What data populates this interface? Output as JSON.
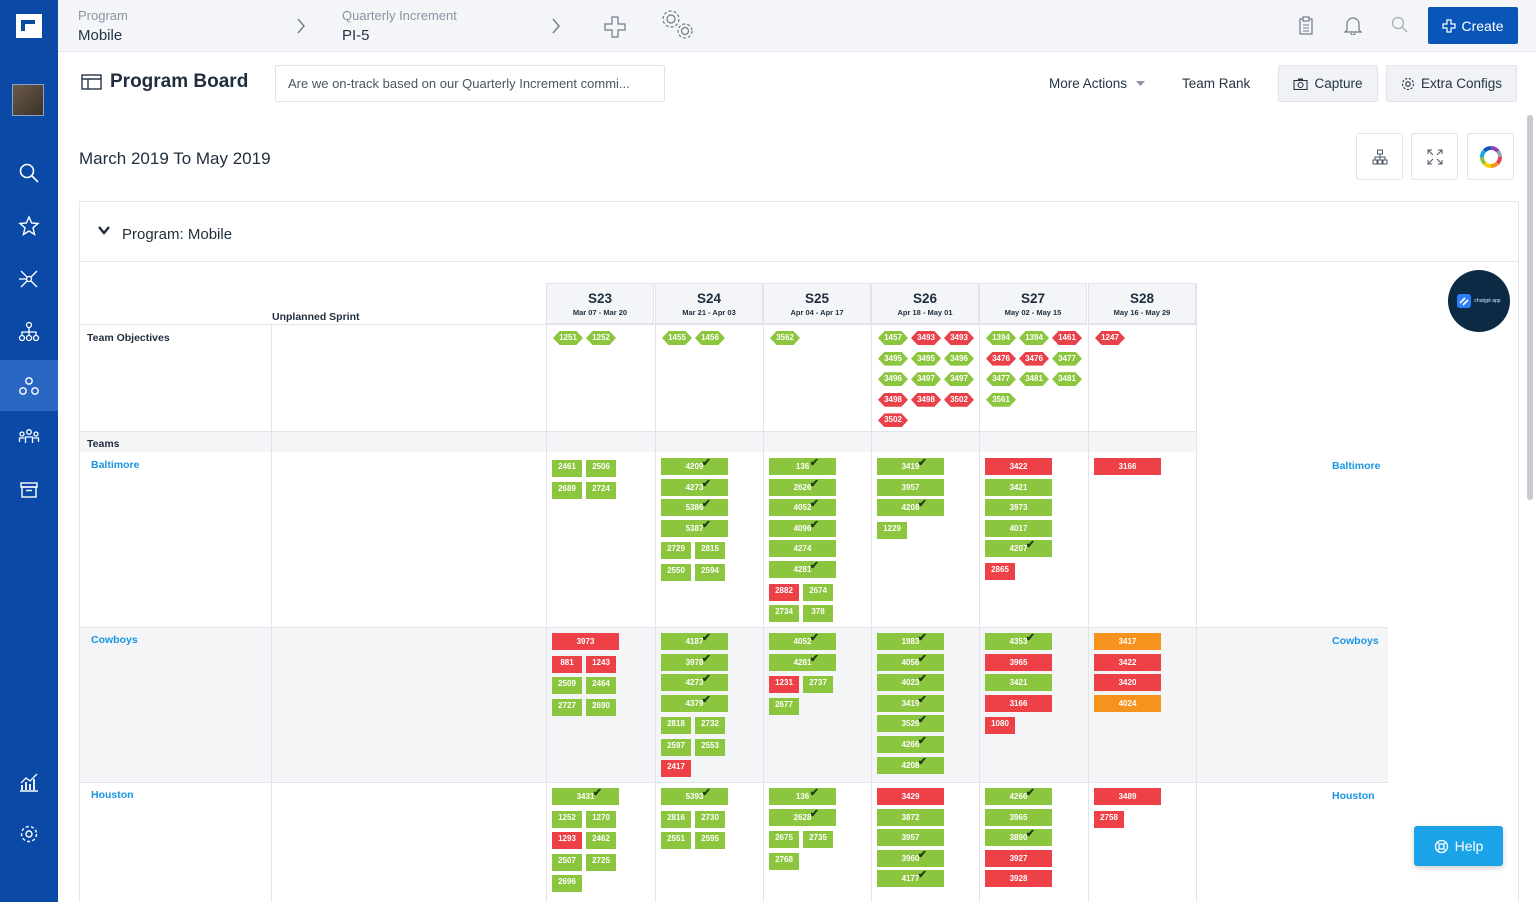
{
  "nav": {
    "items": [
      "search",
      "favorites",
      "network",
      "hierarchy",
      "program",
      "teams",
      "archive",
      "reports",
      "settings"
    ]
  },
  "topbar": {
    "program_label": "Program",
    "program_value": "Mobile",
    "increment_label": "Quarterly Increment",
    "increment_value": "PI-5",
    "create_label": "Create"
  },
  "header": {
    "title": "Program Board",
    "question": "Are we on-track based on our Quarterly Increment commi...",
    "more_actions": "More Actions",
    "team_rank": "Team Rank",
    "capture": "Capture",
    "extra_configs": "Extra Configs"
  },
  "date_range": "March 2019 To May 2019",
  "program": {
    "label": "Program: Mobile"
  },
  "board": {
    "unplanned_label": "Unplanned Sprint",
    "objectives_label": "Team Objectives",
    "teams_label": "Teams",
    "sprints": [
      {
        "name": "S23",
        "dates": "Mar 07 - Mar 20"
      },
      {
        "name": "S24",
        "dates": "Mar 21 - Apr 03"
      },
      {
        "name": "S25",
        "dates": "Apr 04 - Apr 17"
      },
      {
        "name": "S26",
        "dates": "Apr 18 - May 01"
      },
      {
        "name": "S27",
        "dates": "May 02 - May 15"
      },
      {
        "name": "S28",
        "dates": "May 16 - May 29"
      }
    ],
    "objectives": [
      [
        [
          "1251",
          "g"
        ],
        [
          "1252",
          "g"
        ]
      ],
      [
        [
          "1455",
          "g"
        ],
        [
          "1456",
          "g"
        ]
      ],
      [
        [
          "3562",
          "g"
        ]
      ],
      [
        [
          "1457",
          "g"
        ],
        [
          "3493",
          "r"
        ],
        [
          "3493",
          "r"
        ],
        [
          "3495",
          "g"
        ],
        [
          "3495",
          "g"
        ],
        [
          "3496",
          "g"
        ],
        [
          "3496",
          "g"
        ],
        [
          "3497",
          "g"
        ],
        [
          "3497",
          "g"
        ],
        [
          "3498",
          "r"
        ],
        [
          "3498",
          "r"
        ],
        [
          "3502",
          "r"
        ],
        [
          "3502",
          "r"
        ]
      ],
      [
        [
          "1394",
          "g"
        ],
        [
          "1394",
          "g"
        ],
        [
          "1461",
          "r"
        ],
        [
          "3476",
          "r"
        ],
        [
          "3476",
          "r"
        ],
        [
          "3477",
          "g"
        ],
        [
          "3477",
          "g"
        ],
        [
          "3481",
          "g"
        ],
        [
          "3481",
          "g"
        ],
        [
          "3561",
          "g"
        ]
      ],
      [
        [
          "1247",
          "r"
        ]
      ]
    ],
    "teams": [
      {
        "name": "Baltimore",
        "sprints": [
          {
            "small": [
              [
                "2461",
                "g"
              ],
              [
                "2506",
                "g"
              ],
              [
                "2689",
                "g"
              ],
              [
                "2724",
                "g"
              ]
            ]
          },
          {
            "rects": [
              [
                "4209",
                "g",
                1
              ],
              [
                "4273",
                "g",
                1
              ],
              [
                "5386",
                "g",
                1
              ],
              [
                "5387",
                "g",
                1
              ]
            ],
            "small": [
              [
                "2729",
                "g"
              ],
              [
                "2815",
                "g"
              ],
              [
                "2550",
                "g"
              ],
              [
                "2594",
                "g"
              ]
            ]
          },
          {
            "rects": [
              [
                "136",
                "g",
                1
              ],
              [
                "2626",
                "g",
                1
              ],
              [
                "4052",
                "g",
                1
              ],
              [
                "4096",
                "g",
                1
              ],
              [
                "4274",
                "g",
                0
              ],
              [
                "4281",
                "g",
                1
              ]
            ],
            "small": [
              [
                "2882",
                "r"
              ],
              [
                "2674",
                "g"
              ],
              [
                "2734",
                "g"
              ],
              [
                "378",
                "g"
              ]
            ]
          },
          {
            "rects": [
              [
                "3419",
                "g",
                1
              ],
              [
                "3957",
                "g",
                0
              ],
              [
                "4208",
                "g",
                1
              ]
            ],
            "small": [
              [
                "1229",
                "g"
              ]
            ]
          },
          {
            "rects": [
              [
                "3422",
                "r",
                0
              ],
              [
                "3421",
                "g",
                0
              ],
              [
                "3973",
                "g",
                0
              ],
              [
                "4017",
                "g",
                0
              ],
              [
                "4207",
                "g",
                1
              ]
            ],
            "small": [
              [
                "2865",
                "r"
              ]
            ]
          },
          {
            "rects": [
              [
                "3166",
                "r",
                0
              ]
            ]
          }
        ]
      },
      {
        "name": "Cowboys",
        "sprints": [
          {
            "rects": [
              [
                "3973",
                "r",
                0
              ]
            ],
            "small": [
              [
                "881",
                "r"
              ],
              [
                "1243",
                "r"
              ],
              [
                "2509",
                "g"
              ],
              [
                "2464",
                "g"
              ],
              [
                "2727",
                "g"
              ],
              [
                "2690",
                "g"
              ]
            ]
          },
          {
            "rects": [
              [
                "4187",
                "g",
                1
              ],
              [
                "3978",
                "g",
                1
              ],
              [
                "4273",
                "g",
                1
              ],
              [
                "4379",
                "g",
                1
              ]
            ],
            "small": [
              [
                "2818",
                "g"
              ],
              [
                "2732",
                "g"
              ],
              [
                "2597",
                "g"
              ],
              [
                "2553",
                "g"
              ],
              [
                "2417",
                "r"
              ]
            ]
          },
          {
            "rects": [
              [
                "4052",
                "g",
                1
              ],
              [
                "4281",
                "g",
                1
              ]
            ],
            "small": [
              [
                "1231",
                "r"
              ],
              [
                "2737",
                "g"
              ],
              [
                "2677",
                "g"
              ]
            ]
          },
          {
            "rects": [
              [
                "1983",
                "g",
                1
              ],
              [
                "4056",
                "g",
                1
              ],
              [
                "4023",
                "g",
                1
              ],
              [
                "3419",
                "g",
                1
              ],
              [
                "3526",
                "g",
                1
              ],
              [
                "4266",
                "g",
                1
              ],
              [
                "4208",
                "g",
                1
              ]
            ]
          },
          {
            "rects": [
              [
                "4353",
                "g",
                1
              ],
              [
                "3965",
                "r",
                0
              ],
              [
                "3421",
                "g",
                0
              ],
              [
                "3166",
                "r",
                0
              ]
            ],
            "small": [
              [
                "1080",
                "r"
              ]
            ]
          },
          {
            "rects": [
              [
                "3417",
                "o",
                0
              ],
              [
                "3422",
                "r",
                0
              ],
              [
                "3420",
                "r",
                0
              ],
              [
                "4024",
                "o",
                0
              ]
            ]
          }
        ]
      },
      {
        "name": "Houston",
        "sprints": [
          {
            "rects": [
              [
                "3431",
                "g",
                1
              ]
            ],
            "small": [
              [
                "1252",
                "g"
              ],
              [
                "1270",
                "g"
              ],
              [
                "1293",
                "r"
              ],
              [
                "2462",
                "g"
              ],
              [
                "2507",
                "g"
              ],
              [
                "2725",
                "g"
              ],
              [
                "2696",
                "g"
              ]
            ]
          },
          {
            "rects": [
              [
                "5393",
                "g",
                1
              ]
            ],
            "small": [
              [
                "2816",
                "g"
              ],
              [
                "2730",
                "g"
              ],
              [
                "2551",
                "g"
              ],
              [
                "2595",
                "g"
              ]
            ]
          },
          {
            "rects": [
              [
                "136",
                "g",
                1
              ],
              [
                "2628",
                "g",
                1
              ]
            ],
            "small": [
              [
                "2675",
                "g"
              ],
              [
                "2735",
                "g"
              ],
              [
                "2768",
                "g"
              ]
            ]
          },
          {
            "rects": [
              [
                "3429",
                "r",
                0
              ],
              [
                "3872",
                "g",
                0
              ],
              [
                "3957",
                "g",
                0
              ],
              [
                "3960",
                "g",
                1
              ],
              [
                "4177",
                "g",
                1
              ]
            ]
          },
          {
            "rects": [
              [
                "4266",
                "g",
                1
              ],
              [
                "3965",
                "g",
                0
              ],
              [
                "3890",
                "g",
                1
              ],
              [
                "3927",
                "r",
                0
              ],
              [
                "3928",
                "r",
                0
              ]
            ]
          },
          {
            "rects": [
              [
                "3489",
                "r",
                0
              ]
            ],
            "small": [
              [
                "2758",
                "r"
              ]
            ]
          }
        ]
      }
    ]
  },
  "help_label": "Help",
  "badge_text": "chatgpt app",
  "colors": {
    "sidebar": "#0a4aa6",
    "green": "#8cc63f",
    "red": "#ee4047",
    "orange": "#f6921e",
    "team_link": "#1996e3",
    "create": "#0a56b8"
  }
}
